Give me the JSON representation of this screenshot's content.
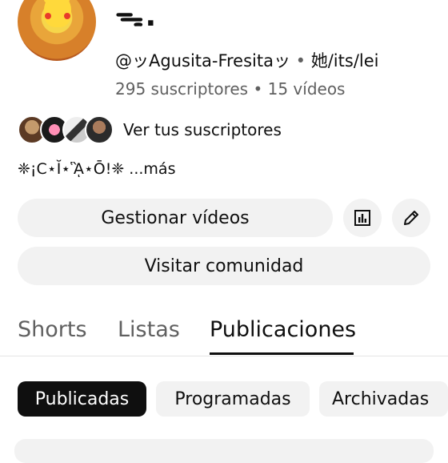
{
  "channel": {
    "title_mark": "ᯓ.",
    "handle": "@ッAgusita-Fresitaッ",
    "pronouns_separator": " • ",
    "pronouns": "她/its/lei",
    "subscribers": "295 suscriptores",
    "stats_separator": " • ",
    "videos": "15 vídeos",
    "subscribers_link": "Ver tus suscriptores",
    "bio": "❈¡C⋆Ĭ⋆ᾋ⋆Ō!❈",
    "more": " ...más"
  },
  "buttons": {
    "manage_videos": "Gestionar vídeos",
    "visit_community": "Visitar comunidad"
  },
  "tabs": [
    {
      "label": "Shorts"
    },
    {
      "label": "Listas"
    },
    {
      "label": "Publicaciones",
      "active": true
    }
  ],
  "chips": [
    {
      "label": "Publicadas",
      "selected": true
    },
    {
      "label": "Programadas"
    },
    {
      "label": "Archivadas"
    }
  ],
  "colors": {
    "text": "#0f0f0f",
    "secondary": "#606060",
    "chip_bg": "#f2f2f2",
    "selected_chip": "#0f0f0f"
  }
}
